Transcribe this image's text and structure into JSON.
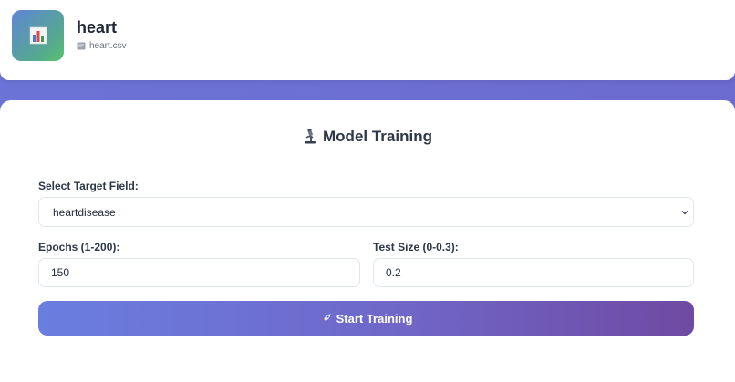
{
  "header": {
    "dataset_name": "heart",
    "file_name": "heart.csv",
    "logo_icon": "bar-chart-icon",
    "file_icon": "file-card-icon"
  },
  "training": {
    "title": "Model Training",
    "title_icon": "microscope-icon",
    "target_label": "Select Target Field:",
    "target_value": "heartdisease",
    "epochs_label": "Epochs (1-200):",
    "epochs_value": "150",
    "test_size_label": "Test Size (0-0.3):",
    "test_size_value": "0.2",
    "button_label": "Start Training",
    "button_icon": "rocket-icon"
  },
  "colors": {
    "background_accent": "#6c6fd3",
    "button_start": "#6a7ee0",
    "button_end": "#6f4aa3"
  }
}
